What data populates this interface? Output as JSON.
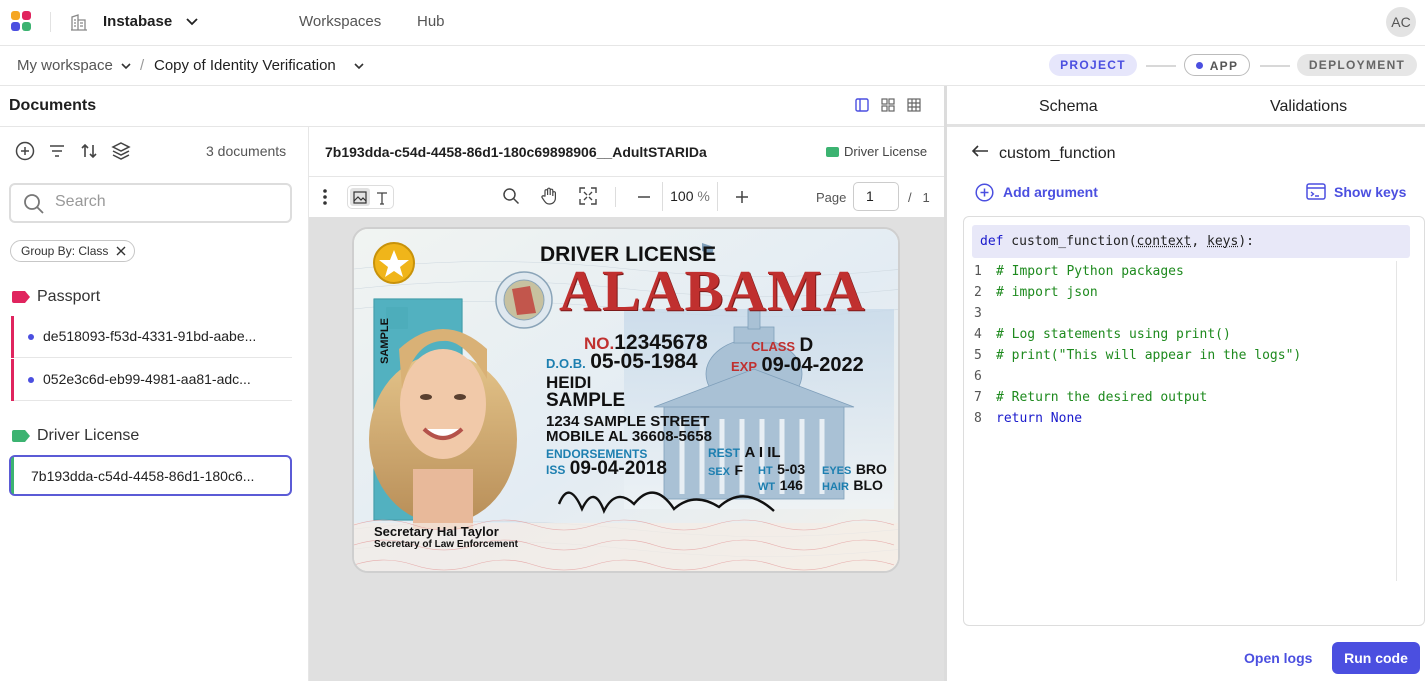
{
  "app": {
    "org_name": "Instabase",
    "avatar_initials": "AC",
    "nav": [
      "Workspaces",
      "Hub"
    ]
  },
  "breadcrumb": {
    "workspace": "My workspace",
    "project": "Copy of Identity Verification"
  },
  "stepper": {
    "steps": [
      "PROJECT",
      "APP",
      "DEPLOYMENT"
    ],
    "active": "PROJECT"
  },
  "documents": {
    "title": "Documents",
    "count_label": "3 documents",
    "search_placeholder": "Search",
    "group_chip": "Group By: Class",
    "groups": [
      {
        "label": "Passport",
        "color": "#e0245e",
        "items": [
          "de518093-f53d-4331-91bd-aabe...",
          "052e3c6d-eb99-4981-aa81-adc..."
        ]
      },
      {
        "label": "Driver License",
        "color": "#3cb371",
        "items": [
          "7b193dda-c54d-4458-86d1-180c6..."
        ]
      }
    ]
  },
  "viewer": {
    "file_name": "7b193dda-c54d-4458-86d1-180c69898906__AdultSTARIDa",
    "class_label": "Driver License",
    "zoom_value": "100",
    "zoom_unit": "%",
    "page_label": "Page",
    "page_current": "1",
    "page_sep": "/",
    "page_total": "1"
  },
  "license": {
    "header": "DRIVER LICENSE",
    "state": "ALABAMA",
    "sample_tag": "SAMPLE",
    "no_label": "NO.",
    "no_value": "12345678",
    "class_label": "CLASS",
    "class_value": "D",
    "dob_label": "D.O.B.",
    "dob_value": "05-05-1984",
    "exp_label": "EXP",
    "exp_value": "09-04-2022",
    "first_name": "HEIDI",
    "last_name": "SAMPLE",
    "address_1": "1234 SAMPLE STREET",
    "address_2": "MOBILE AL 36608-5658",
    "endorsements_label": "ENDORSEMENTS",
    "rest_label": "REST",
    "rest_value": "A I IL",
    "iss_label": "ISS",
    "iss_value": "09-04-2018",
    "sex_label": "SEX",
    "sex_value": "F",
    "ht_label": "HT",
    "ht_value": "5-03",
    "wt_label": "WT",
    "wt_value": "146",
    "eyes_label": "EYES",
    "eyes_value": "BRO",
    "hair_label": "HAIR",
    "hair_value": "BLO",
    "secretary_name": "Secretary Hal Taylor",
    "secretary_title": "Secretary of Law Enforcement",
    "signature": "Heidi Sample"
  },
  "right_panel": {
    "tabs": [
      "Schema",
      "Validations"
    ],
    "function_name": "custom_function",
    "add_argument": "Add argument",
    "show_keys": "Show keys",
    "code_header": {
      "kw": "def",
      "name": " custom_function(",
      "arg1": "context",
      "sep": ", ",
      "arg2": "keys",
      "end": "):"
    },
    "code_lines": [
      {
        "n": "1",
        "text": "# Import Python packages",
        "kind": "comment"
      },
      {
        "n": "2",
        "text": "# import json",
        "kind": "comment"
      },
      {
        "n": "3",
        "text": "",
        "kind": "code"
      },
      {
        "n": "4",
        "text": "# Log statements using print()",
        "kind": "comment"
      },
      {
        "n": "5",
        "text": "# print(\"This will appear in the logs\")",
        "kind": "comment"
      },
      {
        "n": "6",
        "text": "",
        "kind": "code"
      },
      {
        "n": "7",
        "text": "# Return the desired output",
        "kind": "comment"
      },
      {
        "n": "8",
        "text": "return None",
        "kind": "keyword"
      }
    ],
    "open_logs": "Open logs",
    "run_code": "Run code"
  }
}
